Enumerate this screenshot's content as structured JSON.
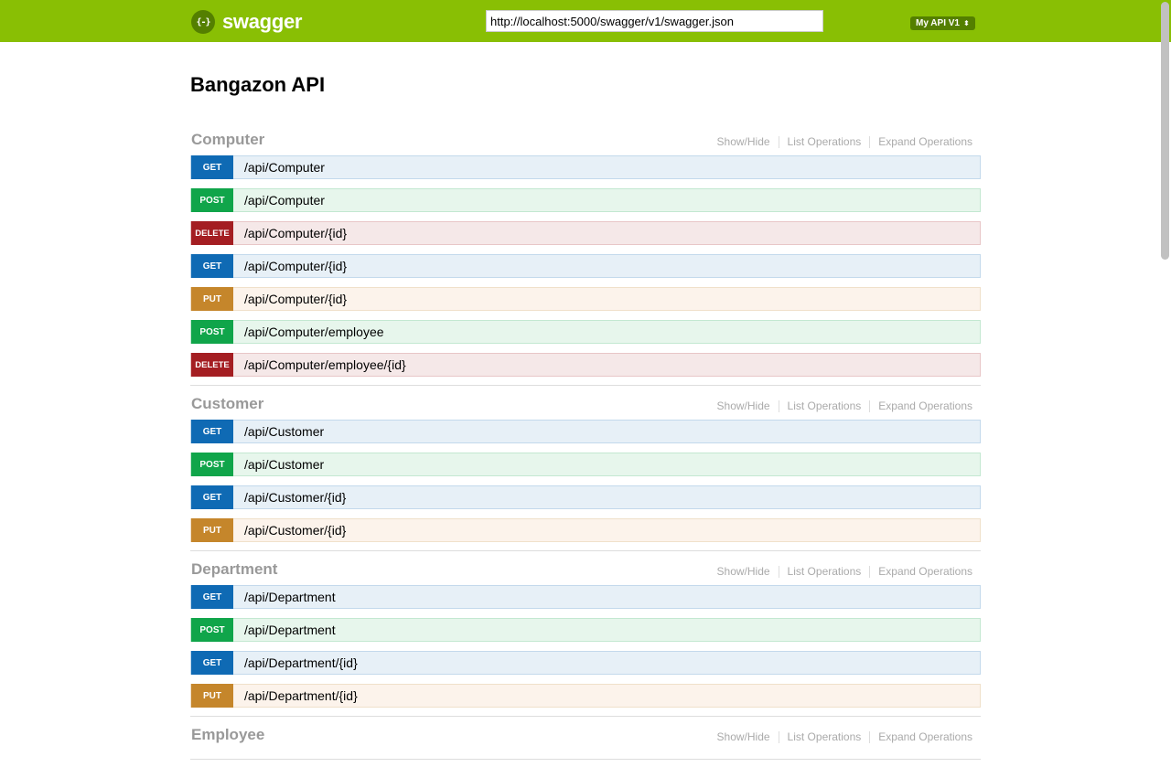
{
  "header": {
    "logo_text": "swagger",
    "logo_icon": "{-}",
    "url_value": "http://localhost:5000/swagger/v1/swagger.json",
    "spec_select": "My API V1",
    "spec_select_arrows": "⬍",
    "brand_color": "#89bf04"
  },
  "page": {
    "title": "Bangazon API"
  },
  "resource_links": {
    "show_hide": "Show/Hide",
    "list_operations": "List Operations",
    "expand_operations": "Expand Operations"
  },
  "resources": [
    {
      "name": "Computer",
      "operations": [
        {
          "method": "GET",
          "path": "/api/Computer"
        },
        {
          "method": "POST",
          "path": "/api/Computer"
        },
        {
          "method": "DELETE",
          "path": "/api/Computer/{id}"
        },
        {
          "method": "GET",
          "path": "/api/Computer/{id}"
        },
        {
          "method": "PUT",
          "path": "/api/Computer/{id}"
        },
        {
          "method": "POST",
          "path": "/api/Computer/employee"
        },
        {
          "method": "DELETE",
          "path": "/api/Computer/employee/{id}"
        }
      ]
    },
    {
      "name": "Customer",
      "operations": [
        {
          "method": "GET",
          "path": "/api/Customer"
        },
        {
          "method": "POST",
          "path": "/api/Customer"
        },
        {
          "method": "GET",
          "path": "/api/Customer/{id}"
        },
        {
          "method": "PUT",
          "path": "/api/Customer/{id}"
        }
      ]
    },
    {
      "name": "Department",
      "operations": [
        {
          "method": "GET",
          "path": "/api/Department"
        },
        {
          "method": "POST",
          "path": "/api/Department"
        },
        {
          "method": "GET",
          "path": "/api/Department/{id}"
        },
        {
          "method": "PUT",
          "path": "/api/Department/{id}"
        }
      ]
    },
    {
      "name": "Employee",
      "operations": []
    }
  ]
}
